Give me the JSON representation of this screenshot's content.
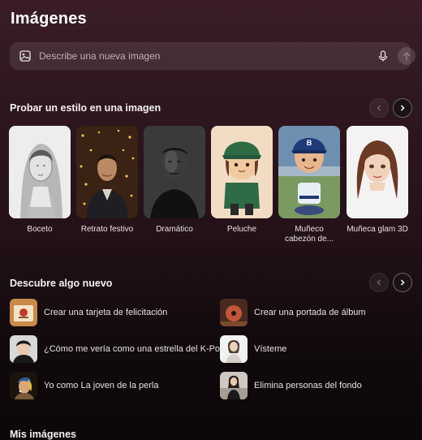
{
  "page": {
    "title": "Imágenes"
  },
  "search": {
    "placeholder": "Describe una nueva imagen",
    "image_icon": "image-icon",
    "mic_icon": "microphone-icon",
    "send_icon": "arrow-up-icon"
  },
  "styles_section": {
    "title": "Probar un estilo en una imagen",
    "prev_icon": "chevron-left-icon",
    "next_icon": "chevron-right-icon",
    "cards": [
      {
        "label": "Boceto"
      },
      {
        "label": "Retrato festivo"
      },
      {
        "label": "Dramático"
      },
      {
        "label": "Peluche"
      },
      {
        "label": "Muñeco cabezón de..."
      },
      {
        "label": "Muñeca glam 3D"
      }
    ]
  },
  "discover_section": {
    "title": "Descubre algo nuevo",
    "items": [
      {
        "text": "Crear una tarjeta de felicitación"
      },
      {
        "text": "Crear una portada de álbum"
      },
      {
        "text": "¿Cómo me vería como una estrella del K-Pop?"
      },
      {
        "text": "Vísteme"
      },
      {
        "text": "Yo como La joven de la perla"
      },
      {
        "text": "Elimina personas del fondo"
      }
    ]
  },
  "my_images": {
    "title": "Mis imágenes"
  }
}
